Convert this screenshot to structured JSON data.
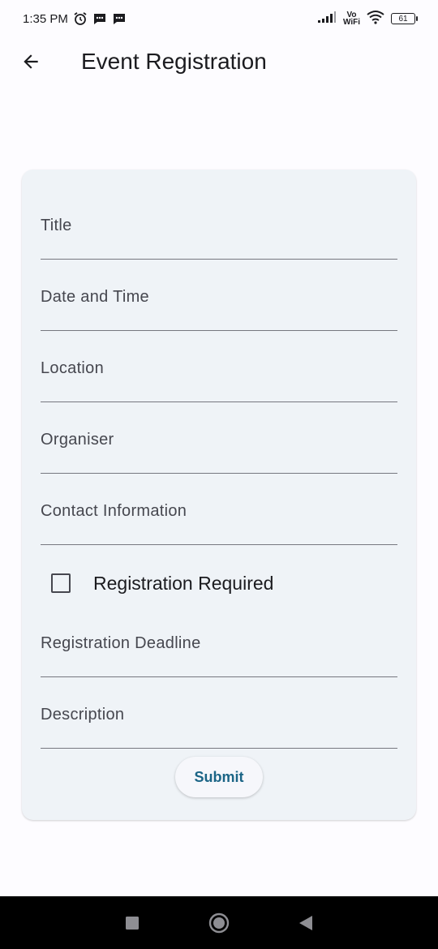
{
  "status_bar": {
    "time": "1:35 PM",
    "vo_label": "Vo",
    "wifi_label": "WiFi",
    "battery": "61",
    "icons": [
      "alarm-icon",
      "message-icon",
      "message-icon",
      "signal-icon",
      "wifi-icon",
      "battery-icon"
    ]
  },
  "app_bar": {
    "title": "Event Registration",
    "back_icon": "arrow-back-icon"
  },
  "form": {
    "fields": [
      {
        "label": "Title"
      },
      {
        "label": "Date and Time"
      },
      {
        "label": "Location"
      },
      {
        "label": "Organiser"
      },
      {
        "label": "Contact Information"
      },
      {
        "label": "Registration Deadline"
      },
      {
        "label": "Description"
      }
    ],
    "checkbox": {
      "label": "Registration Required",
      "checked": false
    },
    "submit_label": "Submit"
  },
  "nav_bar": {
    "icons": [
      "recents-square-icon",
      "home-circle-icon",
      "back-triangle-icon"
    ]
  },
  "colors": {
    "background": "#fdfcff",
    "card": "#eff3f7",
    "accent": "#1b6586",
    "text": "#1b1b1f",
    "label": "#46474f"
  }
}
